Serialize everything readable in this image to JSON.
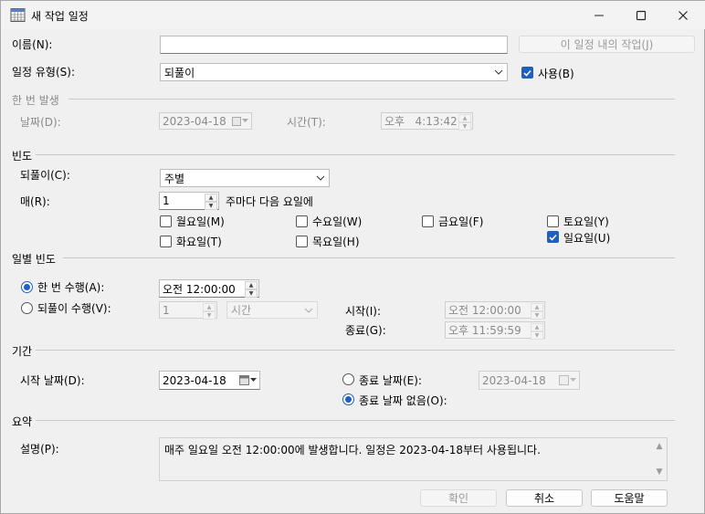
{
  "window": {
    "title": "새 작업 일정",
    "minimize_glyph": "—",
    "maximize_glyph": "☐",
    "close_glyph": "✕"
  },
  "name": {
    "label": "이름(N):",
    "value": "",
    "tasks_button": "이 일정 내의 작업(J)"
  },
  "schedule_type": {
    "label": "일정 유형(S):",
    "value": "되풀이",
    "enabled_label": "사용(B)",
    "enabled": true
  },
  "one_time": {
    "section": "한 번 발생",
    "date_label": "날짜(D):",
    "date_value": "2023-04-18",
    "time_label": "시간(T):",
    "time_value": "오후   4:13:42"
  },
  "frequency": {
    "section": "빈도",
    "recurs_label": "되풀이(C):",
    "recurs_value": "주별",
    "every_label": "매(R):",
    "every_value": "1",
    "every_suffix": "주마다 다음 요일에",
    "days": [
      {
        "label": "월요일(M)",
        "checked": false
      },
      {
        "label": "수요일(W)",
        "checked": false
      },
      {
        "label": "금요일(F)",
        "checked": false
      },
      {
        "label": "토요일(Y)",
        "checked": false
      },
      {
        "label": "화요일(T)",
        "checked": false
      },
      {
        "label": "목요일(H)",
        "checked": false
      },
      {
        "label": "일요일(U)",
        "checked": true
      }
    ]
  },
  "daily_frequency": {
    "section": "일별 빈도",
    "once_label": "한 번 수행(A):",
    "once_selected": true,
    "once_time": "오전 12:00:00",
    "recur_label": "되풀이 수행(V):",
    "recur_value": "1",
    "recur_unit": "시간",
    "start_label": "시작(I):",
    "start_value": "오전 12:00:00",
    "end_label": "종료(G):",
    "end_value": "오후 11:59:59"
  },
  "duration": {
    "section": "기간",
    "start_label": "시작 날짜(D):",
    "start_value": "2023-04-18",
    "end_date_label": "종료 날짜(E):",
    "end_date_value": "2023-04-18",
    "end_date_selected": false,
    "no_end_label": "종료 날짜 없음(O):",
    "no_end_selected": true
  },
  "summary": {
    "section": "요약",
    "desc_label": "설명(P):",
    "text": "매주 일요일 오전 12:00:00에 발생합니다. 일정은 2023-04-18부터 사용됩니다."
  },
  "buttons": {
    "ok": "확인",
    "cancel": "취소",
    "help": "도움말"
  },
  "colors": {
    "accent": "#1f5fbf",
    "disabled_text": "#8a8a8a",
    "dialog_bg": "#f0f0f0"
  }
}
